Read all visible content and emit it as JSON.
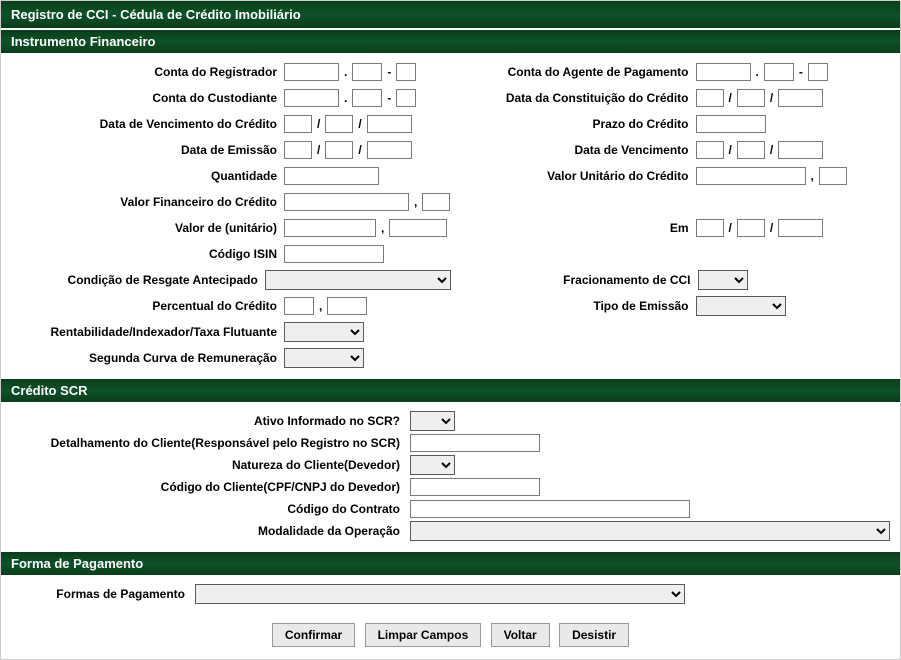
{
  "title": "Registro de CCI - Cédula de Crédito Imobiliário",
  "sections": {
    "instrumento": {
      "header": "Instrumento Financeiro",
      "labels": {
        "conta_registrador": "Conta do Registrador",
        "conta_agente_pagamento": "Conta do Agente de Pagamento",
        "conta_custodiante": "Conta do Custodiante",
        "data_constituicao_credito": "Data da Constituição do Crédito",
        "data_vencimento_credito": "Data de Vencimento do Crédito",
        "prazo_credito": "Prazo do Crédito",
        "data_emissao": "Data de Emissão",
        "data_vencimento": "Data de Vencimento",
        "quantidade": "Quantidade",
        "valor_unitario_credito": "Valor Unitário do Crédito",
        "valor_financeiro_credito": "Valor Financeiro do Crédito",
        "valor_de_unitario": "Valor de (unitário)",
        "em": "Em",
        "codigo_isin": "Código ISIN",
        "condicao_resgate": "Condição de Resgate Antecipado",
        "fracionamento_cci": "Fracionamento de CCI",
        "percentual_credito": "Percentual do Crédito",
        "tipo_emissao": "Tipo de Emissão",
        "rentabilidade": "Rentabilidade/Indexador/Taxa Flutuante",
        "segunda_curva": "Segunda Curva de Remuneração"
      },
      "sep_dot": ".",
      "sep_dash": "-",
      "sep_slash": "/",
      "sep_comma": ","
    },
    "credito_scr": {
      "header": "Crédito SCR",
      "labels": {
        "ativo_informado": "Ativo Informado no SCR?",
        "detalhamento_cliente": "Detalhamento do Cliente(Responsável pelo Registro no SCR)",
        "natureza_cliente": "Natureza do Cliente(Devedor)",
        "codigo_cliente": "Código do Cliente(CPF/CNPJ do Devedor)",
        "codigo_contrato": "Código do Contrato",
        "modalidade_operacao": "Modalidade da Operação"
      }
    },
    "forma_pagamento": {
      "header": "Forma de Pagamento",
      "labels": {
        "formas_pagamento": "Formas de Pagamento"
      }
    }
  },
  "buttons": {
    "confirmar": "Confirmar",
    "limpar": "Limpar Campos",
    "voltar": "Voltar",
    "desistir": "Desistir"
  }
}
